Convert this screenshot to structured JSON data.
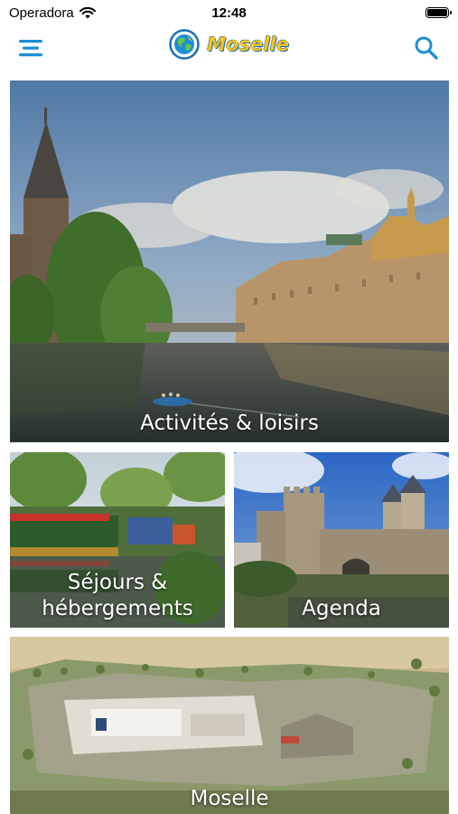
{
  "status_bar": {
    "carrier": "Operadora",
    "time": "12:48"
  },
  "header": {
    "title": "Moselle",
    "menu_icon": "hamburger-menu-icon",
    "search_icon": "search-icon",
    "logo_icon": "globe-logo-icon"
  },
  "tiles": [
    {
      "label": "Activités & loisirs"
    },
    {
      "label": "Séjours &\nhébergements"
    },
    {
      "label": "Agenda"
    },
    {
      "label": "Moselle"
    }
  ],
  "colors": {
    "accent_blue": "#1b8fd6",
    "brand_yellow": "#f6c319"
  }
}
